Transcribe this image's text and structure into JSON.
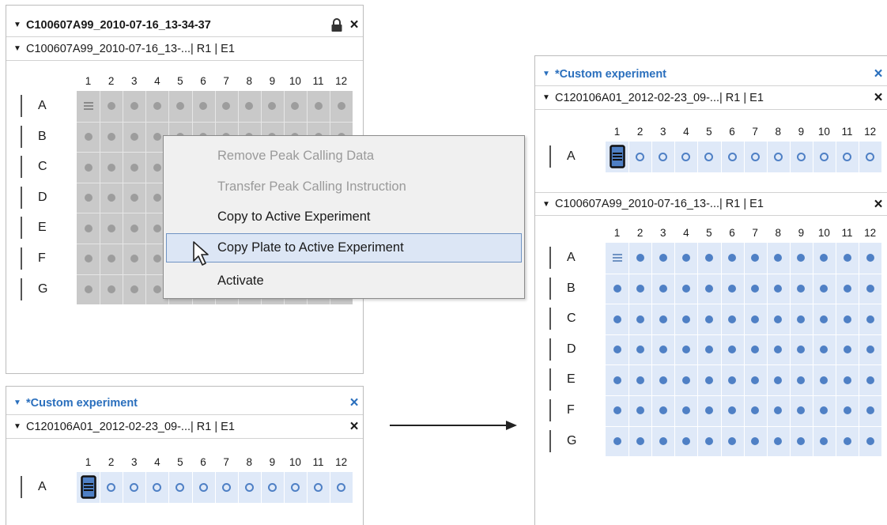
{
  "colors": {
    "accent_blue": "#2a6fbd",
    "gray_well": "#9d9d9d",
    "blue_well": "#4f80c5",
    "menu_highlight": "#dce6f5"
  },
  "top_left": {
    "group_title": "C100607A99_2010-07-16_13-34-37",
    "plate_title": "C100607A99_2010-07-16_13-...| R1 | E1",
    "lock_icon": "lock-icon",
    "close_icon": "×",
    "columns": [
      "1",
      "2",
      "3",
      "4",
      "5",
      "6",
      "7",
      "8",
      "9",
      "10",
      "11",
      "12"
    ],
    "rows": [
      "A",
      "B",
      "C",
      "D",
      "E",
      "F",
      "G"
    ]
  },
  "context_menu": {
    "items": [
      {
        "label": "Remove Peak Calling Data",
        "enabled": false
      },
      {
        "label": "Transfer Peak Calling Instruction",
        "enabled": false
      },
      {
        "label": "Copy to Active Experiment",
        "enabled": true
      },
      {
        "label": "Copy Plate to Active Experiment",
        "enabled": true,
        "highlighted": true
      },
      {
        "label": "Activate",
        "enabled": true
      }
    ]
  },
  "bottom_left": {
    "group_title": "*Custom experiment",
    "plate_title": "C120106A01_2012-02-23_09-...| R1 | E1",
    "close_icon": "×",
    "columns": [
      "1",
      "2",
      "3",
      "4",
      "5",
      "6",
      "7",
      "8",
      "9",
      "10",
      "11",
      "12"
    ],
    "rows": [
      "A"
    ]
  },
  "right": {
    "group_title": "*Custom experiment",
    "plate1_title": "C120106A01_2012-02-23_09-...| R1 | E1",
    "plate2_title": "C100607A99_2010-07-16_13-...| R1 | E1",
    "close_icon": "×",
    "columns": [
      "1",
      "2",
      "3",
      "4",
      "5",
      "6",
      "7",
      "8",
      "9",
      "10",
      "11",
      "12"
    ],
    "plate1_rows": [
      "A"
    ],
    "plate2_rows": [
      "A",
      "B",
      "C",
      "D",
      "E",
      "F",
      "G"
    ]
  }
}
